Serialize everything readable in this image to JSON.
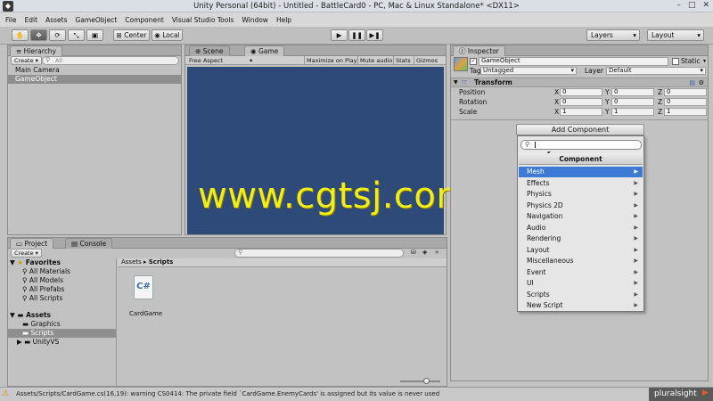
{
  "window": {
    "title": "Unity Personal (64bit) - Untitled - BattleCard0 - PC, Mac & Linux Standalone* <DX11>",
    "controls": [
      "–",
      "□",
      "✕"
    ]
  },
  "menu": [
    "File",
    "Edit",
    "Assets",
    "GameObject",
    "Component",
    "Visual Studio Tools",
    "Window",
    "Help"
  ],
  "toolbar": {
    "pivot_label": "Center",
    "space_label": "Local",
    "layers_label": "Layers",
    "layout_label": "Layout"
  },
  "hierarchy": {
    "tab": "Hierarchy",
    "create_label": "Create",
    "search_placeholder": "All",
    "items": [
      "Main Camera",
      "GameObject"
    ]
  },
  "scene_tabs": [
    "Scene",
    "Game"
  ],
  "game_toolbar": {
    "aspect": "Free Aspect",
    "buttons": [
      "Maximize on Play",
      "Mute audio",
      "Stats",
      "Gizmos"
    ]
  },
  "watermark": "www.cgtsj.com",
  "inspector": {
    "tab": "Inspector",
    "object_name": "GameObject",
    "static_label": "Static",
    "tag_label": "Tag",
    "tag_value": "Untagged",
    "layer_label": "Layer",
    "layer_value": "Default",
    "component_title": "Transform",
    "rows": [
      {
        "label": "Position",
        "x": "0",
        "y": "0",
        "z": "0"
      },
      {
        "label": "Rotation",
        "x": "0",
        "y": "0",
        "z": "0"
      },
      {
        "label": "Scale",
        "x": "1",
        "y": "1",
        "z": "1"
      }
    ],
    "add_component_label": "Add Component"
  },
  "component_popup": {
    "header": "Component",
    "items": [
      "Mesh",
      "Effects",
      "Physics",
      "Physics 2D",
      "Navigation",
      "Audio",
      "Rendering",
      "Layout",
      "Miscellaneous",
      "Event",
      "UI",
      "Scripts",
      "New Script"
    ],
    "highlighted": "Mesh"
  },
  "project": {
    "tabs": [
      "Project",
      "Console"
    ],
    "create_label": "Create",
    "favorites_label": "Favorites",
    "favorites": [
      "All Materials",
      "All Models",
      "All Prefabs",
      "All Scripts"
    ],
    "assets_label": "Assets",
    "folders": [
      "Graphics",
      "Scripts",
      "UnityVS"
    ],
    "breadcrumb": [
      "Assets",
      "Scripts"
    ],
    "file_icon_text": "C#",
    "file_name": "CardGame"
  },
  "status": {
    "message": "Assets/Scripts/CardGame.cs(16,19): warning CS0414: The private field `CardGame.EnemyCards' is assigned but its value is never used",
    "brand": "pluralsight"
  },
  "colors": {
    "game_view": "#2e4a78",
    "highlight": "#3d7ad6",
    "watermark": "#f2ec18"
  }
}
